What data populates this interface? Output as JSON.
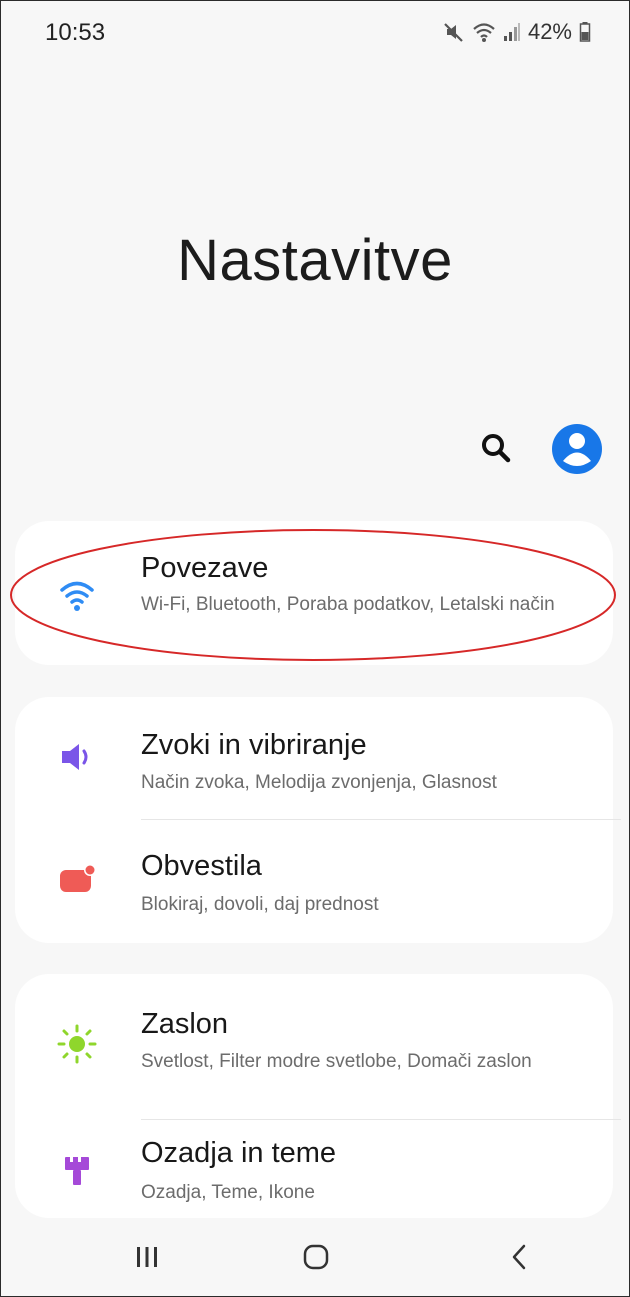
{
  "status_bar": {
    "time": "10:53",
    "battery_text": "42%",
    "icons": [
      "mute-icon",
      "wifi-status-icon",
      "signal-icon",
      "battery-icon"
    ]
  },
  "header": {
    "title": "Nastavitve",
    "icons": [
      "search-icon",
      "account-icon"
    ]
  },
  "colors": {
    "accent_blue": "#1877e8",
    "wifi_icon": "#2f8cf4",
    "sound_icon": "#7a55e8",
    "notification_icon": "#ef5b56",
    "display_icon": "#8fd62c",
    "theme_icon": "#a549d8",
    "highlight": "#d62828"
  },
  "groups": [
    {
      "items": [
        {
          "title": "Povezave",
          "subtitle": "Wi-Fi, Bluetooth, Poraba podatkov, Letalski način",
          "icon": "wifi-icon"
        }
      ]
    },
    {
      "items": [
        {
          "title": "Zvoki in vibriranje",
          "subtitle": "Način zvoka, Melodija zvonjenja, Glasnost",
          "icon": "volume-icon"
        },
        {
          "title": "Obvestila",
          "subtitle": "Blokiraj, dovoli, daj prednost",
          "icon": "notification-icon"
        }
      ]
    },
    {
      "items": [
        {
          "title": "Zaslon",
          "subtitle": "Svetlost, Filter modre svetlobe, Domači zaslon",
          "icon": "brightness-icon"
        },
        {
          "title": "Ozadja in teme",
          "subtitle": "Ozadja, Teme, Ikone",
          "icon": "brush-icon"
        }
      ]
    }
  ],
  "navigation": {
    "buttons": [
      "recents-icon",
      "home-icon",
      "back-icon"
    ]
  }
}
